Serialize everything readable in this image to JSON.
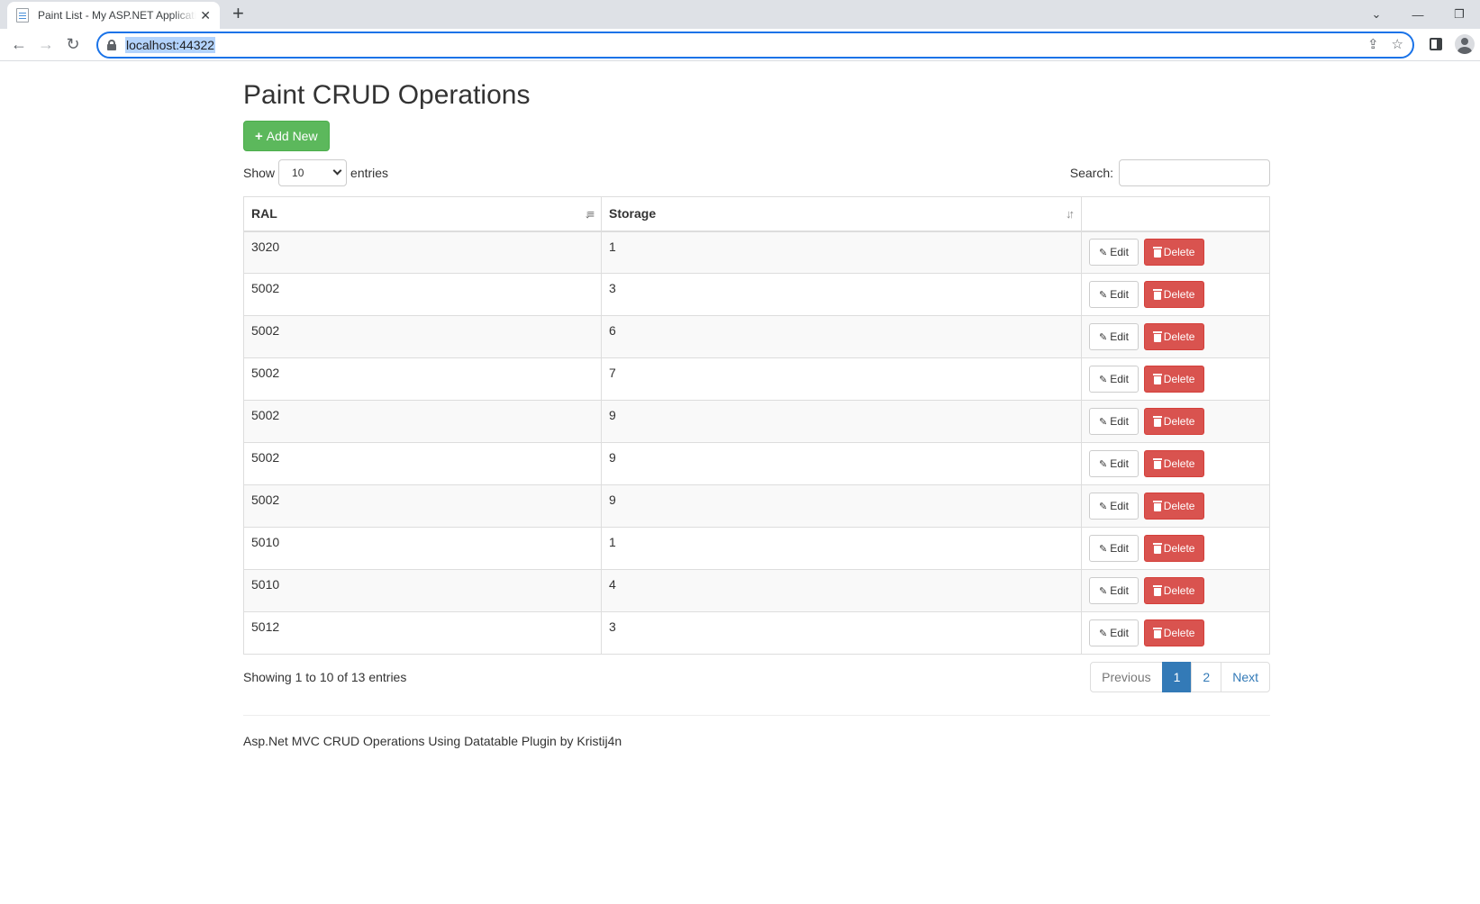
{
  "browser": {
    "tab_title": "Paint List - My ASP.NET Application",
    "url": "localhost:44322"
  },
  "page": {
    "title": "Paint CRUD Operations",
    "add_button": "Add New",
    "show_label": "Show",
    "entries_label": "entries",
    "page_length": "10",
    "search_label": "Search:",
    "search_value": ""
  },
  "table": {
    "columns": [
      "RAL",
      "Storage"
    ],
    "rows": [
      {
        "ral": "3020",
        "storage": "1"
      },
      {
        "ral": "5002",
        "storage": "3"
      },
      {
        "ral": "5002",
        "storage": "6"
      },
      {
        "ral": "5002",
        "storage": "7"
      },
      {
        "ral": "5002",
        "storage": "9"
      },
      {
        "ral": "5002",
        "storage": "9"
      },
      {
        "ral": "5002",
        "storage": "9"
      },
      {
        "ral": "5010",
        "storage": "1"
      },
      {
        "ral": "5010",
        "storage": "4"
      },
      {
        "ral": "5012",
        "storage": "3"
      }
    ],
    "edit_label": "Edit",
    "delete_label": "Delete"
  },
  "info": "Showing 1 to 10 of 13 entries",
  "pagination": {
    "previous": "Previous",
    "pages": [
      "1",
      "2"
    ],
    "next": "Next"
  },
  "footer": "Asp.Net MVC CRUD Operations Using Datatable Plugin by Kristij4n",
  "colors": {
    "success": "#5cb85c",
    "danger": "#d9534f",
    "primary": "#337ab7"
  }
}
